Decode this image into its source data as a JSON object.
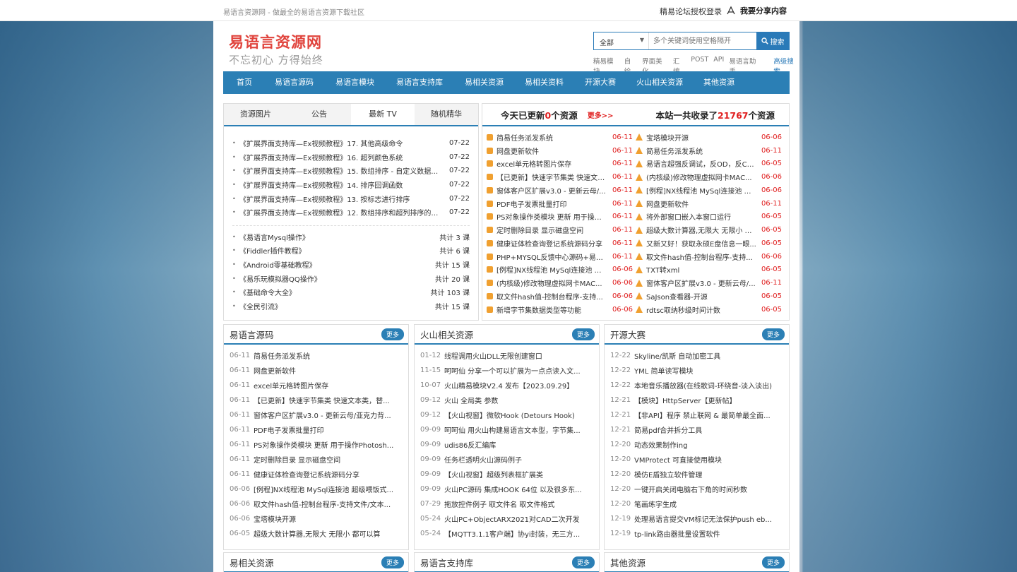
{
  "topbar": {
    "tagline": "易语言资源网 - 做最全的易语言资源下载社区",
    "login": "精易论坛授权登录",
    "share": "我要分享内容"
  },
  "logo": {
    "title": "易语言资源网",
    "subtitle": "不忘初心 方得始终"
  },
  "search": {
    "category": "全部",
    "placeholder": "多个关键词使用空格隔开",
    "button": "搜索",
    "hotwords": [
      "精易模块",
      "自绘",
      "界面美化",
      "汇编",
      "POST",
      "API",
      "易语言助手"
    ],
    "advanced": "高级搜索"
  },
  "nav": [
    "首页",
    "易语言源码",
    "易语言模块",
    "易语言支持库",
    "易相关资源",
    "易相关资料",
    "开源大赛",
    "火山相关资源",
    "其他资源"
  ],
  "tabs": {
    "items": [
      "资源图片",
      "公告",
      "最新 TV",
      "随机精华"
    ],
    "active": 2
  },
  "tv_list": [
    {
      "t": "《扩展界面支持库—Ex视频教程》17. 其他高级命令",
      "d": "07-22"
    },
    {
      "t": "《扩展界面支持库—Ex视频教程》16. 超列颜色系统",
      "d": "07-22"
    },
    {
      "t": "《扩展界面支持库—Ex视频教程》15. 数组排序 - 自定义数据类型...",
      "d": "07-22"
    },
    {
      "t": "《扩展界面支持库—Ex视频教程》14. 排序回调函数",
      "d": "07-22"
    },
    {
      "t": "《扩展界面支持库—Ex视频教程》13. 按标志进行排序",
      "d": "07-22"
    },
    {
      "t": "《扩展界面支持库—Ex视频教程》12. 数组排序和超列排序的区别",
      "d": "07-22"
    }
  ],
  "course_list": [
    {
      "t": "《易语言Mysql操作》",
      "d": "共计 3 课"
    },
    {
      "t": "《Fiddler插件教程》",
      "d": "共计 6 课"
    },
    {
      "t": "《Android零基础教程》",
      "d": "共计 15 课"
    },
    {
      "t": "《易乐玩模拟器QQ操作》",
      "d": "共计 20 课"
    },
    {
      "t": "《基础命令大全》",
      "d": "共计 103 课"
    },
    {
      "t": "《全民引流》",
      "d": "共计 15 课"
    }
  ],
  "updates": {
    "today_pre": "今天已更新",
    "today_count": "0",
    "today_suf": "个资源",
    "more": "更多>>",
    "total_pre": "本站一共收录了",
    "total_count": "21767",
    "total_suf": "个资源",
    "left": [
      {
        "t": "简易任务派发系统",
        "d": "06-11"
      },
      {
        "t": "网盘更新软件",
        "d": "06-11"
      },
      {
        "t": "excel单元格转图片保存",
        "d": "06-11"
      },
      {
        "t": "【已更新】快速字节集类 快速文本类...",
        "d": "06-11"
      },
      {
        "t": "窗体客户区扩展v3.0 - 更新云母/...",
        "d": "06-11"
      },
      {
        "t": "PDF电子发票批量打印",
        "d": "06-11"
      },
      {
        "t": "PS对象操作类模块 更新 用于操作...",
        "d": "06-11"
      },
      {
        "t": "定时删除目录 显示磁盘空间",
        "d": "06-11"
      },
      {
        "t": "健康证体检查询登记系统源码分享",
        "d": "06-11"
      },
      {
        "t": "PHP+MYSQL反馈中心源码+易语...",
        "d": "06-11"
      },
      {
        "t": "[例程]NX线程池 MySql连接池 超...",
        "d": "06-06"
      },
      {
        "t": "(内核级)修改物理虚拟网卡MAC...",
        "d": "06-06"
      },
      {
        "t": "取文件hash值-控制台程序-支持...",
        "d": "06-06"
      },
      {
        "t": "新增字节集数据类型等功能",
        "d": "06-06"
      }
    ],
    "right": [
      {
        "t": "宝塔模块开源",
        "d": "06-06"
      },
      {
        "t": "简易任务派发系统",
        "d": "06-11"
      },
      {
        "t": "易语言超强反调试，反OD，反CE...",
        "d": "06-05"
      },
      {
        "t": "(内核级)修改物理虚拟网卡MAC...",
        "d": "06-06"
      },
      {
        "t": "[例程]NX线程池 MySql连接池 超...",
        "d": "06-06"
      },
      {
        "t": "网盘更新软件",
        "d": "06-11"
      },
      {
        "t": "将外部窗口嵌入本窗口运行",
        "d": "06-05"
      },
      {
        "t": "超级大数计算器,无限大 无限小 都...",
        "d": "06-05"
      },
      {
        "t": "又新又好！获取永硕E盘信息一眼...",
        "d": "06-05"
      },
      {
        "t": "取文件hash值-控制台程序-支持...",
        "d": "06-06"
      },
      {
        "t": "TXT转xml",
        "d": "06-05"
      },
      {
        "t": "窗体客户区扩展v3.0 - 更新云母/...",
        "d": "06-11"
      },
      {
        "t": "SaJson查看器-开源",
        "d": "06-05"
      },
      {
        "t": "rdtsc取纳秒级时间计数",
        "d": "06-05"
      }
    ]
  },
  "panels": [
    {
      "title": "易语言源码",
      "more": "更多",
      "items": [
        {
          "d": "06-11",
          "t": "简易任务派发系统"
        },
        {
          "d": "06-11",
          "t": "网盘更新软件"
        },
        {
          "d": "06-11",
          "t": "excel单元格转图片保存"
        },
        {
          "d": "06-11",
          "t": "【已更新】快速字节集类 快速文本类，替..."
        },
        {
          "d": "06-11",
          "t": "窗体客户区扩展v3.0 - 更新云母/亚克力背..."
        },
        {
          "d": "06-11",
          "t": "PDF电子发票批量打印"
        },
        {
          "d": "06-11",
          "t": "PS对象操作类模块 更新 用于操作Photosh..."
        },
        {
          "d": "06-11",
          "t": "定时删除目录 显示磁盘空间"
        },
        {
          "d": "06-11",
          "t": "健康证体检查询登记系统源码分享"
        },
        {
          "d": "06-06",
          "t": "[例程]NX线程池 MySql连接池 超级喂饭式..."
        },
        {
          "d": "06-06",
          "t": "取文件hash值-控制台程序-支持文件/文本..."
        },
        {
          "d": "06-06",
          "t": "宝塔模块开源"
        },
        {
          "d": "06-05",
          "t": "超级大数计算器,无限大 无限小 都可以算"
        }
      ]
    },
    {
      "title": "火山相关资源",
      "more": "更多",
      "items": [
        {
          "d": "01-12",
          "t": "线程调用火山DLL无限创建窗口"
        },
        {
          "d": "11-15",
          "t": "呵呵仙 分享一个可以扩展为一点点读入文..."
        },
        {
          "d": "10-07",
          "t": "火山精易模块V2.4 发布【2023.09.29】"
        },
        {
          "d": "09-12",
          "t": "火山 全局类 参数"
        },
        {
          "d": "09-12",
          "t": "【火山视窗】微软Hook (Detours Hook)"
        },
        {
          "d": "09-09",
          "t": "呵呵仙 用火山构建易语言文本型，字节集..."
        },
        {
          "d": "09-09",
          "t": "udis86反汇编库"
        },
        {
          "d": "09-09",
          "t": "任务栏透明火山源码例子"
        },
        {
          "d": "09-09",
          "t": "【火山视窗】超级列表框扩展类"
        },
        {
          "d": "09-09",
          "t": "火山PC源码 集成HOOK 64位 以及很多东..."
        },
        {
          "d": "07-29",
          "t": "拖放控件例子 取文件名 取文件格式"
        },
        {
          "d": "05-24",
          "t": "火山PC+ObjectARX2021对CAD二次开发"
        },
        {
          "d": "05-24",
          "t": "【MQTT3.1.1客户端】协yi封装，无三方..."
        }
      ]
    },
    {
      "title": "开源大赛",
      "more": "更多",
      "items": [
        {
          "d": "12-22",
          "t": "Skyline/凯斯 自动加密工具"
        },
        {
          "d": "12-22",
          "t": "YML 简单读写模块"
        },
        {
          "d": "12-22",
          "t": "本地音乐播放器(在线歌词-环绕音-淡入淡出)"
        },
        {
          "d": "12-21",
          "t": "【模块】HttpServer【更新帖】"
        },
        {
          "d": "12-21",
          "t": "【非API】程序 禁止联网 & 最简单最全面..."
        },
        {
          "d": "12-21",
          "t": "简易pdf合并拆分工具"
        },
        {
          "d": "12-20",
          "t": "动态效果制作ing"
        },
        {
          "d": "12-20",
          "t": "VMProtect 可直接使用模块"
        },
        {
          "d": "12-20",
          "t": "模仿E盾独立软件管理"
        },
        {
          "d": "12-20",
          "t": "一键开启关闭电脑右下角的时间秒数"
        },
        {
          "d": "12-20",
          "t": "笔画练字生成"
        },
        {
          "d": "12-19",
          "t": "处理易语言提交VM标记无法保护push eb..."
        },
        {
          "d": "12-19",
          "t": "tp-link路由器批量设置软件"
        }
      ]
    }
  ],
  "bottom_panels": [
    {
      "title": "易相关资源",
      "more": "更多"
    },
    {
      "title": "易语言支持库",
      "more": "更多"
    },
    {
      "title": "其他资源",
      "more": "更多"
    }
  ],
  "colors": {
    "accent": "#2b7fb5",
    "red": "#e02020",
    "logo": "#e0443d",
    "rss": "#f0a030"
  }
}
